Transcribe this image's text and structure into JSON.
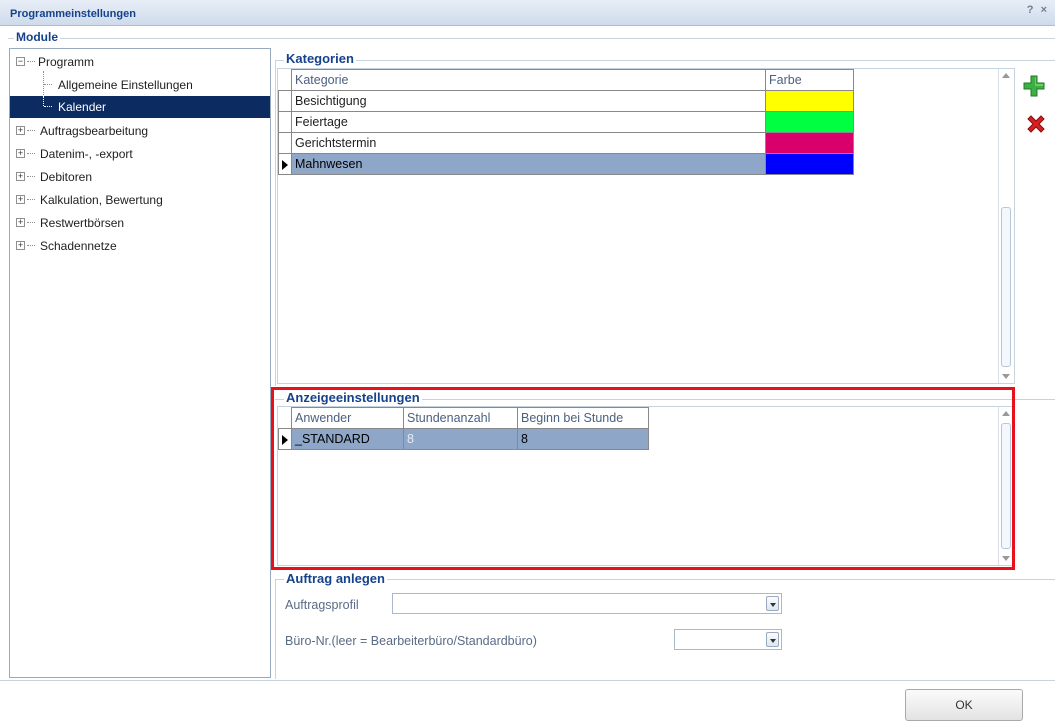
{
  "window": {
    "title": "Programmeinstellungen",
    "help": "? ×"
  },
  "modules": {
    "legend": "Module",
    "tree": [
      {
        "label": "Programm",
        "expander": "−"
      },
      {
        "label": "Allgemeine Einstellungen"
      },
      {
        "label": "Kalender",
        "selected": true
      },
      {
        "label": "Auftragsbearbeitung",
        "expander": "+"
      },
      {
        "label": "Datenim-, -export",
        "expander": "+"
      },
      {
        "label": "Debitoren",
        "expander": "+"
      },
      {
        "label": "Kalkulation, Bewertung",
        "expander": "+"
      },
      {
        "label": "Restwertbörsen",
        "expander": "+"
      },
      {
        "label": "Schadennetze",
        "expander": "+"
      }
    ]
  },
  "kategorien": {
    "title": "Kategorien",
    "columns": [
      "Kategorie",
      "Farbe"
    ],
    "rows": [
      {
        "name": "Besichtigung",
        "color": "#ffff00"
      },
      {
        "name": "Feiertage",
        "color": "#00ff40"
      },
      {
        "name": "Gerichtstermin",
        "color": "#d9006c"
      },
      {
        "name": "Mahnwesen",
        "color": "#0000ff",
        "selected": true
      }
    ],
    "add_icon": "plus-icon",
    "delete_icon": "delete-x-icon"
  },
  "anzeige": {
    "title": "Anzeigeeinstellungen",
    "columns": [
      "Anwender",
      "Stundenanzahl",
      "Beginn bei Stunde"
    ],
    "rows": [
      {
        "anwender": "_STANDARD",
        "stunden": "8",
        "beginn": "8",
        "selected": true
      }
    ]
  },
  "auftrag": {
    "title": "Auftrag anlegen",
    "profil_label": "Auftragsprofil",
    "profil_value": "",
    "buero_label": "Büro-Nr.(leer = Bearbeiterbüro/Standardbüro)",
    "buero_value": ""
  },
  "footer": {
    "ok_label": "OK"
  }
}
